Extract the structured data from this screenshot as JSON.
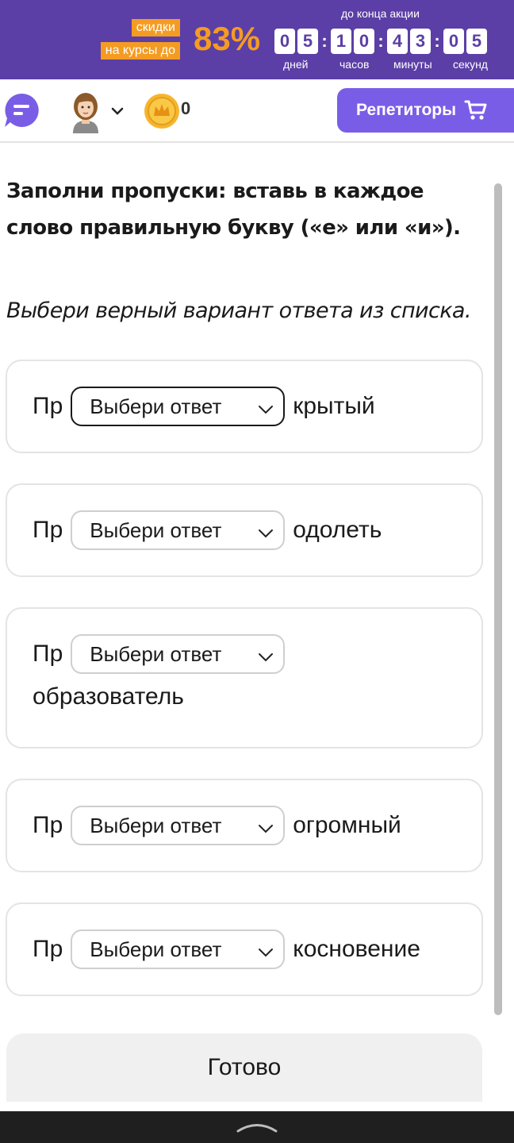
{
  "promo": {
    "tag_line1": "скидки",
    "tag_line2": "на курсы до",
    "percent": "83%",
    "until_label": "до конца акции",
    "timer": {
      "days": [
        "0",
        "5"
      ],
      "hours": [
        "1",
        "0"
      ],
      "minutes": [
        "4",
        "3"
      ],
      "seconds": [
        "0",
        "5"
      ],
      "colon": ":"
    },
    "labels": {
      "days": "дней",
      "hours": "часов",
      "minutes": "минуты",
      "seconds": "секунд"
    },
    "accent_color": "#f49b22",
    "bg_color": "#5b3fa6"
  },
  "header": {
    "coin_count": "0",
    "tutors_label": "Репетиторы",
    "tutors_color": "#7a5de6"
  },
  "task": {
    "question": "Заполни пропуски: вставь в каждое слово правильную букву («е» или «и»).",
    "hint": "Выбери верный вариант ответа из списка.",
    "items": [
      {
        "prefix": "Пр",
        "select": "Выбери ответ",
        "suffix": "крытый"
      },
      {
        "prefix": "Пр",
        "select": "Выбери ответ",
        "suffix": "одолеть"
      },
      {
        "prefix": "Пр",
        "select": "Выбери ответ",
        "suffix": "образователь"
      },
      {
        "prefix": "Пр",
        "select": "Выбери ответ",
        "suffix": "огромный"
      },
      {
        "prefix": "Пр",
        "select": "Выбери ответ",
        "suffix": "косновение"
      }
    ],
    "done_label": "Готово"
  }
}
